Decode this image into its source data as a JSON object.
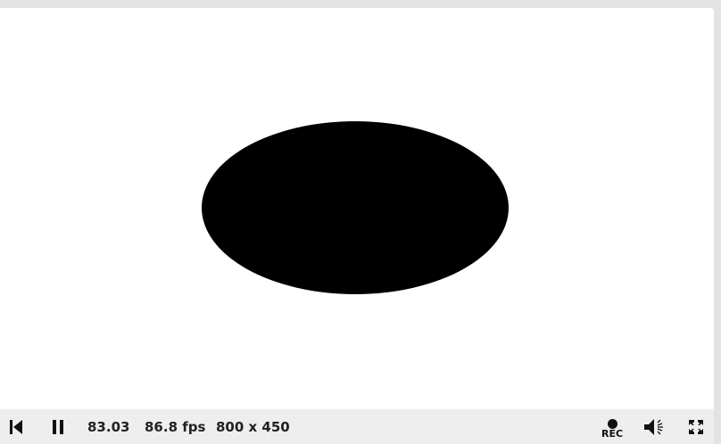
{
  "player": {
    "time": "83.03",
    "fps": "86.8 fps",
    "resolution": "800 x 450",
    "rec_label": "REC"
  },
  "canvas": {
    "background_color": "#ffffff",
    "shape": "ellipse",
    "shape_color": "#000000"
  },
  "icons": {
    "rewind": "skip-back-icon",
    "pause": "pause-icon",
    "record": "record-icon",
    "volume": "volume-icon",
    "fullscreen": "fullscreen-icon"
  },
  "colors": {
    "controls_background": "#eeeeee",
    "frame_background": "#e3e3e3",
    "control_text": "#222222"
  }
}
